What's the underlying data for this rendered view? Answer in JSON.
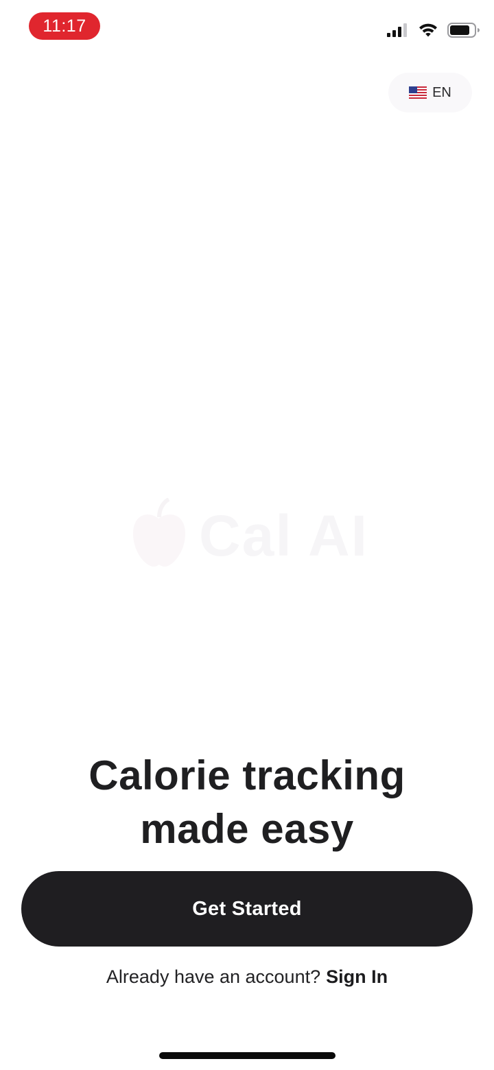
{
  "status_bar": {
    "time": "11:17",
    "time_pill_color": "#e0262e",
    "icons": [
      "signal-icon",
      "wifi-icon",
      "battery-icon"
    ]
  },
  "language": {
    "flag": "us-flag-icon",
    "code": "EN"
  },
  "logo": {
    "text": "Cal AI",
    "icon": "apple-icon",
    "color": "#f6f5f7"
  },
  "headline": {
    "line1": "Calorie tracking",
    "line2": "made easy"
  },
  "primary_button": {
    "label": "Get Started",
    "background": "#1f1e21"
  },
  "signin": {
    "prompt": "Already have an account?",
    "link": "Sign In"
  }
}
